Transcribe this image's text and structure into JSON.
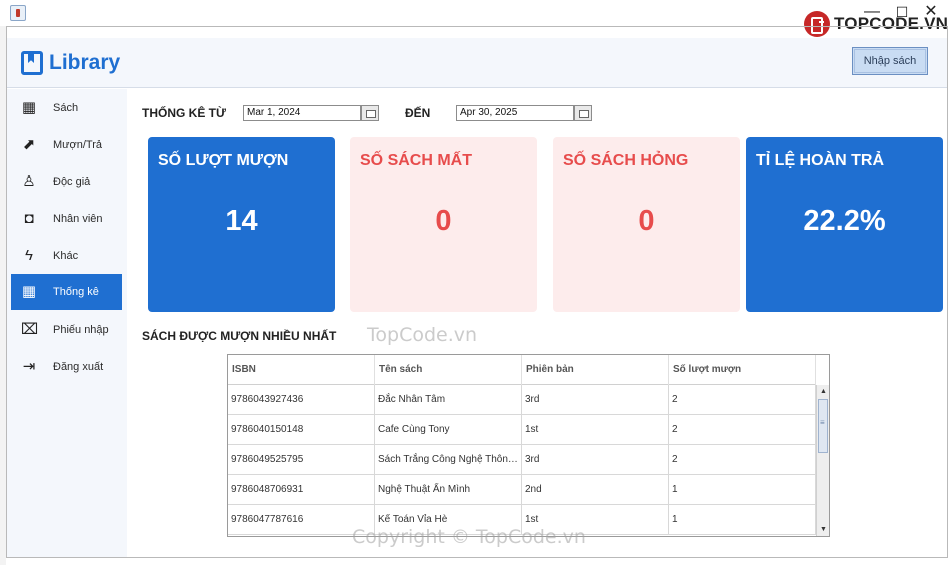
{
  "window": {
    "min_glyph": "—",
    "max_glyph": "☐",
    "close_glyph": "✕"
  },
  "watermark": {
    "logo_text": "TOPCODE.VN",
    "center_text": "TopCode.vn",
    "bottom_text": "Copyright © TopCode.vn"
  },
  "header": {
    "app_name": "Library",
    "import_button": "Nhập sách"
  },
  "sidebar": {
    "items": [
      {
        "label": "Sách",
        "icon": "grid-icon",
        "glyph": "▦"
      },
      {
        "label": "Mượn/Trả",
        "icon": "arrow-box-icon",
        "glyph": "⬈"
      },
      {
        "label": "Độc giả",
        "icon": "reader-icon",
        "glyph": "♙"
      },
      {
        "label": "Nhân viên",
        "icon": "badge-icon",
        "glyph": "◘"
      },
      {
        "label": "Khác",
        "icon": "lightning-icon",
        "glyph": "ϟ"
      },
      {
        "label": "Thống kê",
        "icon": "stats-grid-icon",
        "glyph": "▦"
      },
      {
        "label": "Phiếu nhập",
        "icon": "ticket-icon",
        "glyph": "⌧"
      },
      {
        "label": "Đăng xuất",
        "icon": "logout-icon",
        "glyph": "⇥"
      }
    ],
    "active_index": 5
  },
  "filter": {
    "from_label": "THỐNG KÊ TỪ",
    "from_date": "Mar 1, 2024",
    "to_label": "ĐẾN",
    "to_date": "Apr 30, 2025"
  },
  "cards": [
    {
      "title": "SỐ LƯỢT MƯỢN",
      "value": "14",
      "style": "blue"
    },
    {
      "title": "SỐ SÁCH MẤT",
      "value": "0",
      "style": "pink"
    },
    {
      "title": "SỐ SÁCH HỎNG",
      "value": "0",
      "style": "pink"
    },
    {
      "title": "TỈ LỆ HOÀN TRẢ",
      "value": "22.2%",
      "style": "blue"
    }
  ],
  "colors": {
    "accent": "#1f6fd1",
    "pink_bg": "#fdecec",
    "pink_text": "#e74c4c"
  },
  "table": {
    "title": "SÁCH ĐƯỢC MƯỢN NHIỀU NHẤT",
    "headers": [
      "ISBN",
      "Tên sách",
      "Phiên bản",
      "Số lượt mượn"
    ],
    "rows": [
      [
        "9786043927436",
        "Đắc Nhân Tâm",
        "3rd",
        "2"
      ],
      [
        "9786040150148",
        "Cafe Cùng Tony",
        "1st",
        "2"
      ],
      [
        "9786049525795",
        "Sách Trắng Công Nghệ Thông Tin",
        "3rd",
        "2"
      ],
      [
        "9786048706931",
        "Nghệ Thuật Ẩn Mình",
        "2nd",
        "1"
      ],
      [
        "9786047787616",
        "Kế Toán Vỉa Hè",
        "1st",
        "1"
      ]
    ]
  }
}
